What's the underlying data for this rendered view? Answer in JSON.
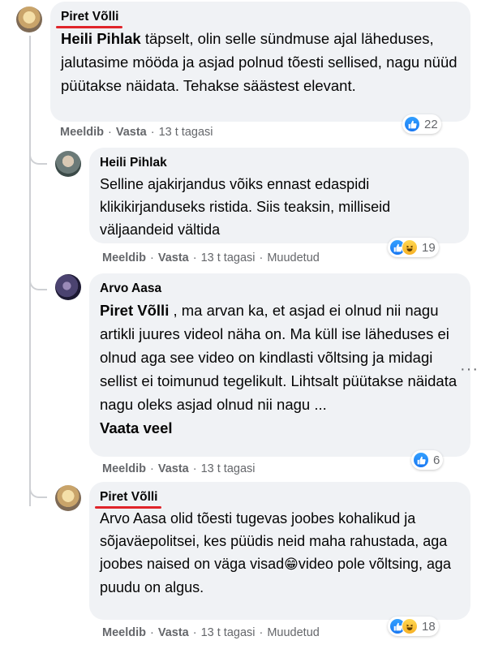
{
  "comments": [
    {
      "author": "Piret Võlli",
      "mention": "Heili Pihlak",
      "text": " täpselt, olin selle sündmuse ajal läheduses, jalutasime mööda ja asjad polnud tõesti sellised, nagu nüüd püütakse näidata. Tehakse säästest elevant.",
      "like_label": "Meeldib",
      "reply_label": "Vasta",
      "time": "13 t tagasi",
      "reaction_count": "22"
    },
    {
      "author": "Heili Pihlak",
      "text": "Selline ajakirjandus võiks ennast edaspidi klikikirjanduseks ristida. Siis teaksin, milliseid väljaandeid vältida",
      "like_label": "Meeldib",
      "reply_label": "Vasta",
      "time": "13 t tagasi",
      "edited": "Muudetud",
      "reaction_count": "19"
    },
    {
      "author": "Arvo Aasa",
      "mention": "Piret Võlli",
      "text": " , ma arvan ka, et asjad ei olnud nii nagu artikli juures videol näha on. Ma küll ise läheduses ei olnud aga see video on kindlasti võltsing ja midagi sellist ei toimunud tegelikult. Lihtsalt püütakse näidata nagu oleks asjad olnud nii nagu ...",
      "see_more": "Vaata veel",
      "like_label": "Meeldib",
      "reply_label": "Vasta",
      "time": "13 t tagasi",
      "reaction_count": "6",
      "more_icon": "···"
    },
    {
      "author": "Piret Võlli",
      "text_before": "Arvo Aasa olid tõesti tugevas joobes kohalikud ja sõjaväepolitsei, kes püüdis neid maha rahustada, aga joobes naised on väga visad",
      "emoji": "😁",
      "text_after": "video pole võltsing, aga puudu on algus.",
      "like_label": "Meeldib",
      "reply_label": "Vasta",
      "time": "13 t tagasi",
      "edited": "Muudetud",
      "reaction_count": "18"
    }
  ],
  "separator": "·",
  "colors": {
    "bubble": "#f0f2f5",
    "meta": "#65676b",
    "like": "#1877f2",
    "underline": "#e0242a"
  },
  "icons": {
    "like": "like-reaction-icon",
    "haha": "haha-reaction-icon"
  }
}
